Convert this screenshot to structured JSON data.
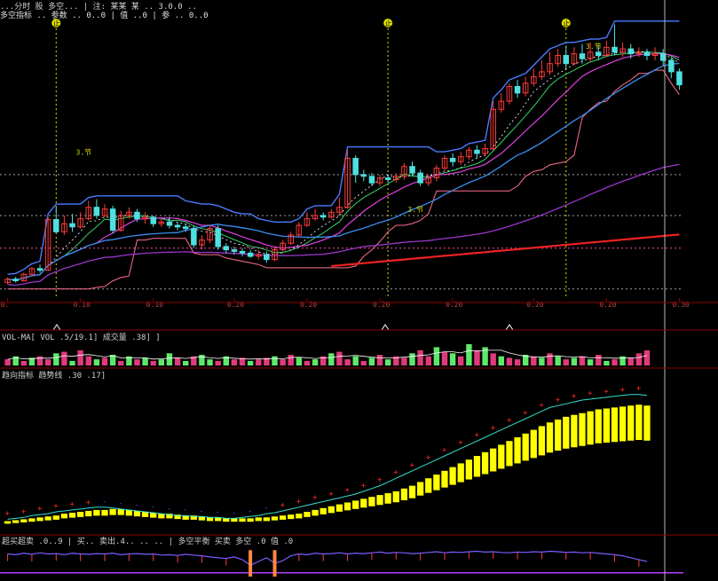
{
  "chart_data": [
    {
      "type": "line",
      "panel": "main-price",
      "candles": [
        {
          "o": 18,
          "c": 22,
          "h": 24,
          "l": 16
        },
        {
          "o": 22,
          "c": 20,
          "h": 25,
          "l": 18
        },
        {
          "o": 20,
          "c": 28,
          "h": 30,
          "l": 19
        },
        {
          "o": 28,
          "c": 35,
          "h": 37,
          "l": 26
        },
        {
          "o": 35,
          "c": 33,
          "h": 40,
          "l": 30
        },
        {
          "o": 33,
          "c": 95,
          "h": 98,
          "l": 32
        },
        {
          "o": 95,
          "c": 80,
          "h": 110,
          "l": 78
        },
        {
          "o": 80,
          "c": 90,
          "h": 100,
          "l": 76
        },
        {
          "o": 90,
          "c": 86,
          "h": 102,
          "l": 80
        },
        {
          "o": 86,
          "c": 96,
          "h": 104,
          "l": 84
        },
        {
          "o": 96,
          "c": 110,
          "h": 118,
          "l": 94
        },
        {
          "o": 110,
          "c": 100,
          "h": 120,
          "l": 96
        },
        {
          "o": 100,
          "c": 108,
          "h": 114,
          "l": 98
        },
        {
          "o": 108,
          "c": 82,
          "h": 112,
          "l": 78
        },
        {
          "o": 82,
          "c": 100,
          "h": 106,
          "l": 80
        },
        {
          "o": 100,
          "c": 104,
          "h": 110,
          "l": 96
        },
        {
          "o": 104,
          "c": 96,
          "h": 108,
          "l": 92
        },
        {
          "o": 96,
          "c": 98,
          "h": 104,
          "l": 90
        },
        {
          "o": 98,
          "c": 90,
          "h": 100,
          "l": 86
        },
        {
          "o": 90,
          "c": 92,
          "h": 96,
          "l": 86
        },
        {
          "o": 92,
          "c": 88,
          "h": 98,
          "l": 84
        },
        {
          "o": 88,
          "c": 86,
          "h": 92,
          "l": 82
        },
        {
          "o": 86,
          "c": 84,
          "h": 90,
          "l": 80
        },
        {
          "o": 84,
          "c": 64,
          "h": 88,
          "l": 60
        },
        {
          "o": 64,
          "c": 70,
          "h": 76,
          "l": 58
        },
        {
          "o": 70,
          "c": 84,
          "h": 88,
          "l": 66
        },
        {
          "o": 84,
          "c": 62,
          "h": 88,
          "l": 58
        },
        {
          "o": 62,
          "c": 58,
          "h": 66,
          "l": 54
        },
        {
          "o": 58,
          "c": 56,
          "h": 62,
          "l": 52
        },
        {
          "o": 56,
          "c": 54,
          "h": 60,
          "l": 50
        },
        {
          "o": 54,
          "c": 50,
          "h": 58,
          "l": 48
        },
        {
          "o": 50,
          "c": 52,
          "h": 58,
          "l": 46
        },
        {
          "o": 52,
          "c": 46,
          "h": 56,
          "l": 42
        },
        {
          "o": 46,
          "c": 58,
          "h": 62,
          "l": 44
        },
        {
          "o": 58,
          "c": 66,
          "h": 70,
          "l": 56
        },
        {
          "o": 66,
          "c": 76,
          "h": 80,
          "l": 64
        },
        {
          "o": 76,
          "c": 88,
          "h": 92,
          "l": 74
        },
        {
          "o": 88,
          "c": 96,
          "h": 104,
          "l": 86
        },
        {
          "o": 96,
          "c": 100,
          "h": 108,
          "l": 94
        },
        {
          "o": 100,
          "c": 98,
          "h": 104,
          "l": 94
        },
        {
          "o": 98,
          "c": 104,
          "h": 108,
          "l": 96
        },
        {
          "o": 104,
          "c": 110,
          "h": 122,
          "l": 100
        },
        {
          "o": 110,
          "c": 170,
          "h": 180,
          "l": 108
        },
        {
          "o": 170,
          "c": 150,
          "h": 174,
          "l": 140
        },
        {
          "o": 150,
          "c": 148,
          "h": 156,
          "l": 142
        },
        {
          "o": 148,
          "c": 140,
          "h": 152,
          "l": 136
        },
        {
          "o": 140,
          "c": 146,
          "h": 150,
          "l": 136
        },
        {
          "o": 146,
          "c": 144,
          "h": 150,
          "l": 140
        },
        {
          "o": 144,
          "c": 148,
          "h": 152,
          "l": 140
        },
        {
          "o": 148,
          "c": 160,
          "h": 164,
          "l": 144
        },
        {
          "o": 160,
          "c": 152,
          "h": 166,
          "l": 148
        },
        {
          "o": 152,
          "c": 140,
          "h": 156,
          "l": 136
        },
        {
          "o": 140,
          "c": 146,
          "h": 150,
          "l": 136
        },
        {
          "o": 146,
          "c": 158,
          "h": 162,
          "l": 142
        },
        {
          "o": 158,
          "c": 170,
          "h": 174,
          "l": 154
        },
        {
          "o": 170,
          "c": 166,
          "h": 176,
          "l": 160
        },
        {
          "o": 166,
          "c": 172,
          "h": 178,
          "l": 162
        },
        {
          "o": 172,
          "c": 180,
          "h": 184,
          "l": 168
        },
        {
          "o": 180,
          "c": 176,
          "h": 186,
          "l": 170
        },
        {
          "o": 176,
          "c": 182,
          "h": 188,
          "l": 172
        },
        {
          "o": 182,
          "c": 230,
          "h": 240,
          "l": 180
        },
        {
          "o": 230,
          "c": 240,
          "h": 250,
          "l": 226
        },
        {
          "o": 240,
          "c": 258,
          "h": 262,
          "l": 236
        },
        {
          "o": 258,
          "c": 250,
          "h": 266,
          "l": 244
        },
        {
          "o": 250,
          "c": 262,
          "h": 270,
          "l": 246
        },
        {
          "o": 262,
          "c": 270,
          "h": 280,
          "l": 258
        },
        {
          "o": 270,
          "c": 276,
          "h": 290,
          "l": 266
        },
        {
          "o": 276,
          "c": 286,
          "h": 300,
          "l": 272
        },
        {
          "o": 286,
          "c": 296,
          "h": 304,
          "l": 282
        },
        {
          "o": 296,
          "c": 286,
          "h": 308,
          "l": 280
        },
        {
          "o": 286,
          "c": 298,
          "h": 306,
          "l": 284
        },
        {
          "o": 298,
          "c": 292,
          "h": 310,
          "l": 286
        },
        {
          "o": 292,
          "c": 300,
          "h": 312,
          "l": 288
        },
        {
          "o": 300,
          "c": 296,
          "h": 308,
          "l": 290
        },
        {
          "o": 296,
          "c": 306,
          "h": 314,
          "l": 294
        },
        {
          "o": 306,
          "c": 300,
          "h": 334,
          "l": 296
        },
        {
          "o": 300,
          "c": 304,
          "h": 312,
          "l": 294
        },
        {
          "o": 304,
          "c": 298,
          "h": 310,
          "l": 292
        },
        {
          "o": 298,
          "c": 300,
          "h": 306,
          "l": 294
        },
        {
          "o": 300,
          "c": 296,
          "h": 304,
          "l": 290
        },
        {
          "o": 296,
          "c": 298,
          "h": 306,
          "l": 290
        },
        {
          "o": 298,
          "c": 290,
          "h": 304,
          "l": 284
        },
        {
          "o": 290,
          "c": 276,
          "h": 294,
          "l": 268
        },
        {
          "o": 276,
          "c": 260,
          "h": 280,
          "l": 254
        }
      ],
      "ylim": [
        0,
        340
      ],
      "overlay_lines": [
        {
          "color": "#4a7cff",
          "role": "upper-channel"
        },
        {
          "color": "#e040e0",
          "role": "mid-average"
        },
        {
          "color": "#3a8ff0",
          "role": "long-average"
        },
        {
          "color": "#9b35c8",
          "role": "slow-average"
        },
        {
          "color": "#ee2222",
          "role": "trend"
        },
        {
          "color": "#ff6f8f",
          "role": "lower-channel"
        }
      ],
      "markers": [
        {
          "label": "止",
          "color": "#dede00"
        },
        {
          "label": "止",
          "color": "#dede00"
        },
        {
          "label": "止",
          "color": "#dede00"
        }
      ],
      "annotations": [
        "3.节",
        "3.节",
        "3.节"
      ],
      "x_tick_labels": [
        "0.",
        "0.10",
        "0.10",
        "0.20",
        "0.20",
        "0.20",
        "0.20",
        "0.20",
        "0.20",
        "0.30"
      ],
      "header_line1": "...分时 股 多空... | 注: 某某 某 .. 3.0.0 ..",
      "header_line2": "多空指标 .. 参数 .. 0..0 | 值 ..0 | 参 .. 0..0"
    },
    {
      "type": "bar",
      "panel": "volume",
      "label": "VOL-MA[ VOL .5/19.1] 成交量 .38] ]",
      "values": [
        4,
        6,
        3,
        5,
        6,
        4,
        8,
        9,
        3,
        10,
        6,
        4,
        5,
        7,
        3,
        6,
        4,
        5,
        3,
        4,
        8,
        5,
        3,
        6,
        7,
        4,
        3,
        6,
        4,
        5,
        3,
        4,
        5,
        6,
        4,
        7,
        5,
        3,
        4,
        6,
        8,
        9,
        4,
        6,
        3,
        5,
        7,
        4,
        6,
        5,
        8,
        10,
        6,
        12,
        9,
        8,
        6,
        14,
        10,
        12,
        8,
        6,
        5,
        4,
        7,
        6,
        5,
        8,
        6,
        4,
        5,
        6,
        4,
        7,
        3,
        4,
        6,
        5,
        8,
        10
      ],
      "up": [
        true,
        false,
        true,
        false,
        true,
        true,
        false,
        true,
        false,
        true,
        true,
        false,
        true,
        false,
        true,
        false,
        true,
        false,
        true,
        false,
        false,
        true,
        false,
        true,
        false,
        false,
        true,
        false,
        true,
        true,
        false,
        true,
        true,
        false,
        true,
        true,
        false,
        true,
        false,
        true,
        false,
        true,
        true,
        false,
        true,
        false,
        true,
        false,
        true,
        true,
        false,
        true,
        true,
        false,
        true,
        false,
        true,
        false,
        true,
        false,
        true,
        false,
        true,
        true,
        false,
        true,
        false,
        true,
        false,
        true,
        false,
        true,
        false,
        true,
        false,
        true,
        false,
        true,
        true,
        true
      ]
    },
    {
      "type": "bar",
      "panel": "indicator",
      "label": "趋向指标 趋势线 .30 .17]",
      "values": [
        10,
        11,
        12,
        13,
        14,
        15,
        16,
        18,
        19,
        20,
        21,
        22,
        22,
        23,
        23,
        22,
        21,
        20,
        19,
        18,
        18,
        17,
        16,
        16,
        15,
        14,
        14,
        13,
        13,
        13,
        13,
        14,
        14,
        15,
        16,
        17,
        18,
        20,
        22,
        24,
        26,
        28,
        30,
        32,
        34,
        36,
        38,
        40,
        42,
        45,
        48,
        52,
        56,
        60,
        64,
        68,
        72,
        76,
        80,
        84,
        88,
        92,
        96,
        100,
        104,
        108,
        112,
        116,
        119,
        122,
        124,
        126,
        128,
        130,
        131,
        132,
        133,
        134,
        135,
        134
      ],
      "signal_line": [
        12,
        13,
        14,
        16,
        17,
        18,
        20,
        21,
        22,
        23,
        24,
        25,
        25,
        24,
        23,
        22,
        21,
        20,
        19,
        18,
        17,
        16,
        16,
        15,
        15,
        14,
        14,
        13,
        13,
        14,
        15,
        16,
        18,
        19,
        21,
        23,
        25,
        27,
        29,
        31,
        33,
        35,
        37,
        39,
        42,
        45,
        48,
        52,
        56,
        60,
        64,
        68,
        72,
        76,
        80,
        84,
        88,
        92,
        96,
        100,
        104,
        108,
        112,
        116,
        120,
        124,
        128,
        132,
        134,
        136,
        138,
        140,
        141,
        142,
        143,
        144,
        145,
        146,
        146,
        145
      ],
      "ylim": [
        0,
        160
      ]
    },
    {
      "type": "line",
      "panel": "oscillator",
      "label": "超买超卖 .0..9 | 买.. 卖出.4.. .. .. | 多空平衡 买卖 多空 .0 值 .0",
      "values": [
        60,
        58,
        62,
        59,
        63,
        60,
        61,
        58,
        62,
        60,
        59,
        61,
        60,
        62,
        58,
        60,
        61,
        59,
        60,
        57,
        58,
        56,
        59,
        57,
        55,
        52,
        50,
        48,
        52,
        45,
        30,
        40,
        50,
        35,
        42,
        55,
        60,
        58,
        62,
        60,
        61,
        63,
        60,
        62,
        61,
        63,
        65,
        62,
        64,
        63,
        61,
        62,
        64,
        66,
        63,
        65,
        64,
        66,
        67,
        65,
        66,
        64,
        63,
        65,
        64,
        66,
        65,
        67,
        66,
        64,
        65,
        63,
        64,
        62,
        60,
        58,
        55,
        50,
        45,
        40
      ],
      "ylim": [
        0,
        80
      ]
    }
  ]
}
